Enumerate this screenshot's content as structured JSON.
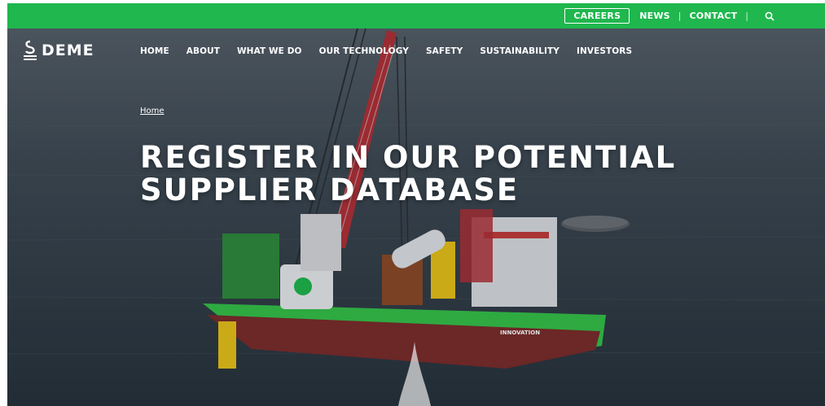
{
  "colors": {
    "brand_green": "#1fb74e",
    "text_light": "#ffffff"
  },
  "topbar": {
    "careers": "CAREERS",
    "news": "NEWS",
    "contact": "CONTACT",
    "search_icon": "search-icon"
  },
  "header": {
    "logo_text": "DEME",
    "nav": [
      {
        "label": "HOME"
      },
      {
        "label": "ABOUT"
      },
      {
        "label": "WHAT WE DO"
      },
      {
        "label": "OUR TECHNOLOGY"
      },
      {
        "label": "SAFETY"
      },
      {
        "label": "SUSTAINABILITY"
      },
      {
        "label": "INVESTORS"
      }
    ]
  },
  "hero": {
    "breadcrumb": "Home",
    "title_line1": "REGISTER IN OUR POTENTIAL",
    "title_line2": "SUPPLIER DATABASE",
    "vessel_name": "INNOVATION"
  }
}
